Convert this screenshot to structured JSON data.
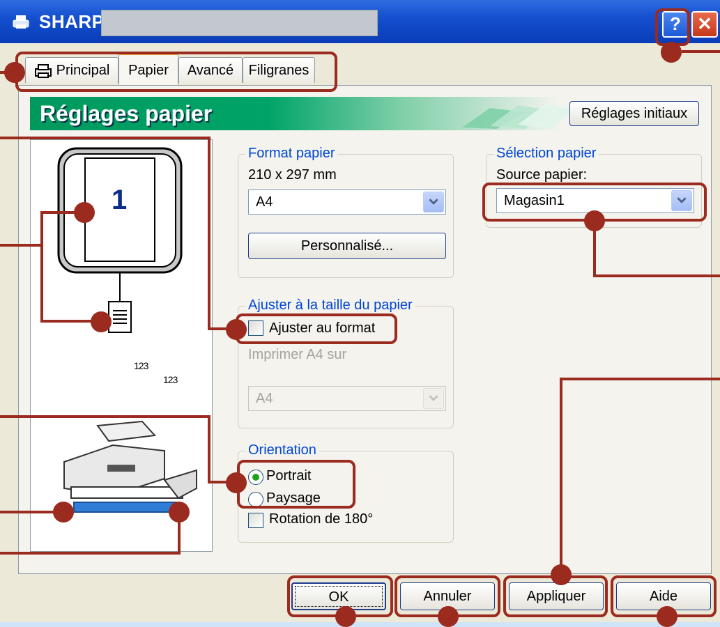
{
  "window": {
    "title": "SHARP",
    "help_label": "?",
    "close_label": "✕"
  },
  "tabs": [
    {
      "label": "Principal"
    },
    {
      "label": "Papier"
    },
    {
      "label": "Avancé"
    },
    {
      "label": "Filigranes"
    }
  ],
  "banner": {
    "title": "Réglages papier"
  },
  "defaults_button": "Réglages initiaux",
  "preview": {
    "page_number": "1",
    "collate_digits": "123"
  },
  "paper_size": {
    "label": "Format papier",
    "dimensions": "210 x 297 mm",
    "selected": "A4",
    "custom_button": "Personnalisé..."
  },
  "fit_to_paper": {
    "label": "Ajuster à la taille du papier",
    "checkbox_label": "Ajuster au format",
    "print_on_label": "Imprimer A4 sur",
    "selected": "A4"
  },
  "orientation": {
    "label": "Orientation",
    "portrait": "Portrait",
    "landscape": "Paysage",
    "rotate": "Rotation de 180°"
  },
  "paper_selection": {
    "label": "Sélection papier",
    "source_label": "Source papier:",
    "selected": "Magasin1"
  },
  "footer": {
    "ok": "OK",
    "cancel": "Annuler",
    "apply": "Appliquer",
    "help": "Aide"
  },
  "colors": {
    "annotation": "#9b2a1f",
    "titlebar": "#1450cf",
    "banner": "#00995d",
    "group_label": "#0046d5"
  }
}
